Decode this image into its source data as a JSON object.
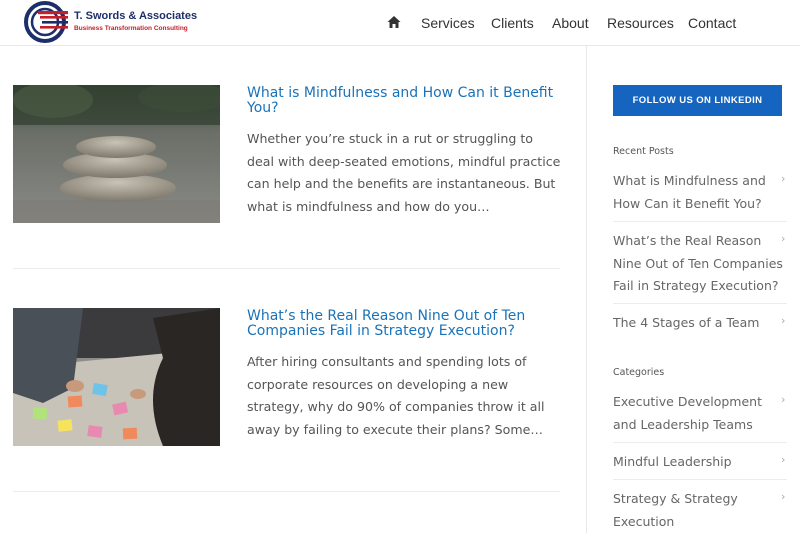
{
  "header": {
    "logo_name": "T. Swords & Associates",
    "logo_tagline": "Business Transformation Consulting",
    "nav": {
      "home_icon": "home-icon",
      "services": "Services",
      "clients": "Clients",
      "about": "About",
      "resources": "Resources",
      "contact": "Contact"
    }
  },
  "posts": [
    {
      "title": "What is Mindfulness and How Can it Benefit You?",
      "excerpt": "Whether you’re stuck in a rut or struggling to deal with deep-seated emotions, mindful practice can help and the benefits are instantaneous. But what is mindfulness and how do you…"
    },
    {
      "title": "What’s the Real Reason Nine Out of Ten Companies Fail in Strategy Execution?",
      "excerpt": "After hiring consultants and spending lots of corporate resources on developing a new strategy, why do 90% of companies throw it all away by failing to execute their plans? Some…"
    }
  ],
  "sidebar": {
    "follow_label": "FOLLOW US ON LINKEDIN",
    "recent_posts_title": "Recent Posts",
    "recent_posts": [
      "What is Mindfulness and How Can it Benefit You?",
      "What’s the Real Reason Nine Out of Ten Companies Fail in Strategy Execution?",
      "The 4 Stages of a Team"
    ],
    "categories_title": "Categories",
    "categories": [
      "Executive Development and Leadership Teams",
      "Mindful Leadership",
      "Strategy & Strategy Execution"
    ],
    "chevron_icon": "chevron-right-icon"
  },
  "colors": {
    "link_blue": "#1a73b8",
    "button_blue": "#1565c0",
    "logo_navy": "#1d2f6b",
    "logo_red": "#c41e2a"
  }
}
